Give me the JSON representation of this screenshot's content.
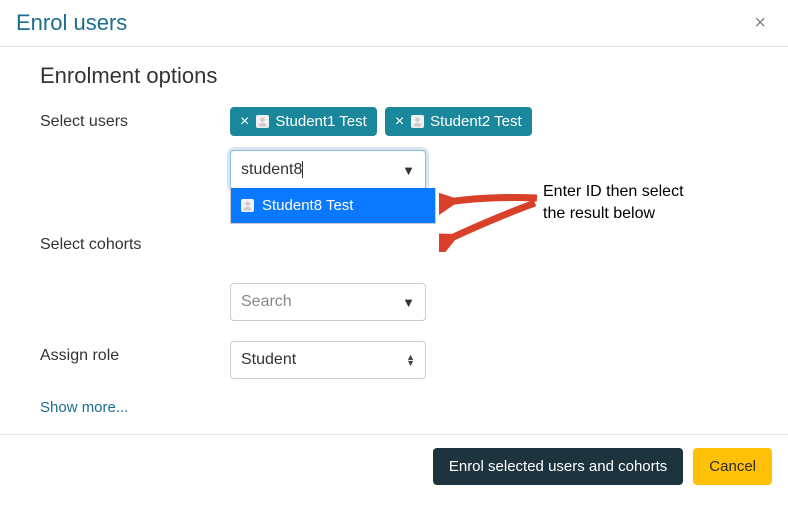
{
  "dialog": {
    "title": "Enrol users",
    "section_title": "Enrolment options"
  },
  "select_users": {
    "label": "Select users",
    "tags": [
      {
        "name": "Student1 Test"
      },
      {
        "name": "Student2 Test"
      }
    ],
    "search_value": "student8",
    "results": [
      {
        "name": "Student8 Test"
      }
    ]
  },
  "select_cohorts": {
    "label": "Select cohorts",
    "placeholder": "Search"
  },
  "assign_role": {
    "label": "Assign role",
    "value": "Student"
  },
  "show_more": "Show more...",
  "footer": {
    "submit": "Enrol selected users and cohorts",
    "cancel": "Cancel"
  },
  "annotation": {
    "line1": "Enter ID then select",
    "line2": "the result below"
  }
}
